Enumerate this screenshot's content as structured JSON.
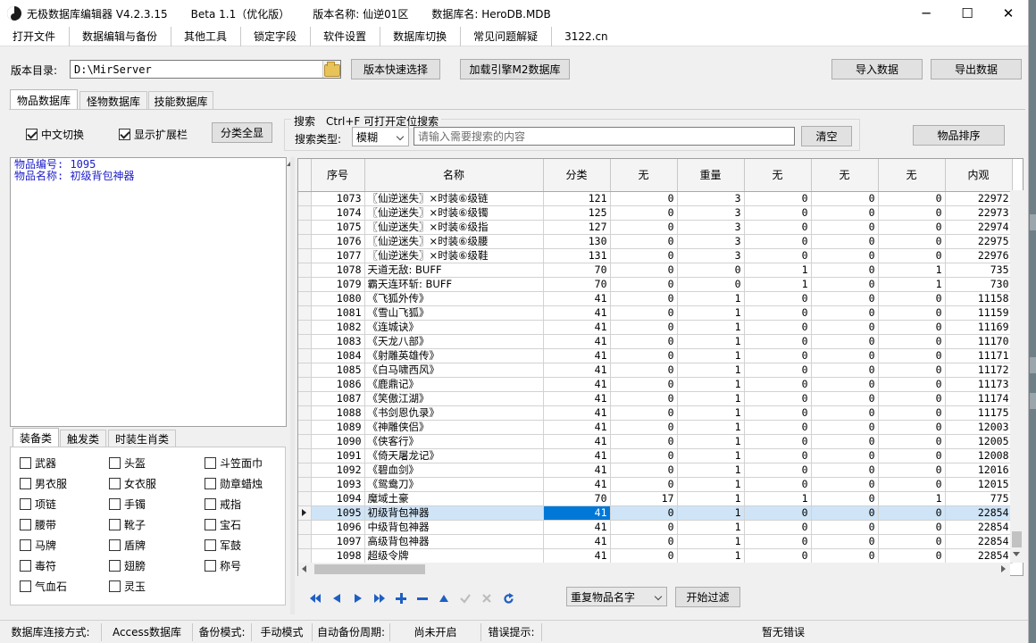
{
  "titlebar": {
    "app_name": "无极数据库编辑器 V4.2.3.15",
    "beta": "Beta 1.1（优化版）",
    "version_name": "版本名称: 仙逆01区",
    "db_name": "数据库名: HeroDB.MDB",
    "minimize": "─",
    "maximize": "☐",
    "close": "✕"
  },
  "menu": [
    "打开文件",
    "数据编辑与备份",
    "其他工具",
    "锁定字段",
    "软件设置",
    "数据库切换",
    "常见问题解疑",
    "3122.cn"
  ],
  "toolbar": {
    "dir_label": "版本目录:",
    "dir_value": "D:\\MirServer",
    "quick_select": "版本快速选择",
    "load_engine": "加载引擎M2数据库",
    "import": "导入数据",
    "export": "导出数据"
  },
  "tabs": [
    "物品数据库",
    "怪物数据库",
    "技能数据库"
  ],
  "options": {
    "chinese_toggle": "中文切换",
    "show_ext_bar": "显示扩展栏",
    "show_all_categories": "分类全显",
    "search_title": "搜索　Ctrl+F 可打开定位搜索",
    "search_type_label": "搜索类型:",
    "search_type_value": "模糊",
    "search_placeholder": "请输入需要搜索的内容",
    "clear": "清空",
    "sort_items": "物品排序"
  },
  "info": {
    "line1": "物品编号: 1095",
    "line2": "物品名称: 初级背包神器"
  },
  "category_tabs": [
    "装备类",
    "触发类",
    "时装生肖类"
  ],
  "categories": [
    "武器",
    "头盔",
    "斗笠面巾",
    "男衣服",
    "女衣服",
    "勋章蜡烛",
    "项链",
    "手镯",
    "戒指",
    "腰带",
    "靴子",
    "宝石",
    "马牌",
    "盾牌",
    "军鼓",
    "毒符",
    "翅膀",
    "称号",
    "气血石",
    "灵玉"
  ],
  "table": {
    "headers": [
      "序号",
      "名称",
      "分类",
      "无",
      "重量",
      "无",
      "无",
      "无",
      "内观"
    ],
    "rows": [
      [
        "1073",
        "〖仙逆迷失〗×时装⑥级链",
        "121",
        "0",
        "3",
        "0",
        "0",
        "0",
        "22972"
      ],
      [
        "1074",
        "〖仙逆迷失〗×时装⑥级镯",
        "125",
        "0",
        "3",
        "0",
        "0",
        "0",
        "22973"
      ],
      [
        "1075",
        "〖仙逆迷失〗×时装⑥级指",
        "127",
        "0",
        "3",
        "0",
        "0",
        "0",
        "22974"
      ],
      [
        "1076",
        "〖仙逆迷失〗×时装⑥级腰",
        "130",
        "0",
        "3",
        "0",
        "0",
        "0",
        "22975"
      ],
      [
        "1077",
        "〖仙逆迷失〗×时装⑥级鞋",
        "131",
        "0",
        "3",
        "0",
        "0",
        "0",
        "22976"
      ],
      [
        "1078",
        "天道无敌: BUFF",
        "70",
        "0",
        "0",
        "1",
        "0",
        "1",
        "735"
      ],
      [
        "1079",
        "霸天连环斩: BUFF",
        "70",
        "0",
        "0",
        "1",
        "0",
        "1",
        "730"
      ],
      [
        "1080",
        "《飞狐外传》",
        "41",
        "0",
        "1",
        "0",
        "0",
        "0",
        "11158"
      ],
      [
        "1081",
        "《雪山飞狐》",
        "41",
        "0",
        "1",
        "0",
        "0",
        "0",
        "11159"
      ],
      [
        "1082",
        "《连城诀》",
        "41",
        "0",
        "1",
        "0",
        "0",
        "0",
        "11169"
      ],
      [
        "1083",
        "《天龙八部》",
        "41",
        "0",
        "1",
        "0",
        "0",
        "0",
        "11170"
      ],
      [
        "1084",
        "《射雕英雄传》",
        "41",
        "0",
        "1",
        "0",
        "0",
        "0",
        "11171"
      ],
      [
        "1085",
        "《白马啸西风》",
        "41",
        "0",
        "1",
        "0",
        "0",
        "0",
        "11172"
      ],
      [
        "1086",
        "《鹿鼎记》",
        "41",
        "0",
        "1",
        "0",
        "0",
        "0",
        "11173"
      ],
      [
        "1087",
        "《笑傲江湖》",
        "41",
        "0",
        "1",
        "0",
        "0",
        "0",
        "11174"
      ],
      [
        "1088",
        "《书剑恩仇录》",
        "41",
        "0",
        "1",
        "0",
        "0",
        "0",
        "11175"
      ],
      [
        "1089",
        "《神雕侠侣》",
        "41",
        "0",
        "1",
        "0",
        "0",
        "0",
        "12003"
      ],
      [
        "1090",
        "《侠客行》",
        "41",
        "0",
        "1",
        "0",
        "0",
        "0",
        "12005"
      ],
      [
        "1091",
        "《倚天屠龙记》",
        "41",
        "0",
        "1",
        "0",
        "0",
        "0",
        "12008"
      ],
      [
        "1092",
        "《碧血剑》",
        "41",
        "0",
        "1",
        "0",
        "0",
        "0",
        "12016"
      ],
      [
        "1093",
        "《鸳鸯刀》",
        "41",
        "0",
        "1",
        "0",
        "0",
        "0",
        "12015"
      ],
      [
        "1094",
        "魔域土豪",
        "70",
        "17",
        "1",
        "1",
        "0",
        "1",
        "775"
      ],
      [
        "1095",
        "初级背包神器",
        "41",
        "0",
        "1",
        "0",
        "0",
        "0",
        "22854"
      ],
      [
        "1096",
        "中级背包神器",
        "41",
        "0",
        "1",
        "0",
        "0",
        "0",
        "22854"
      ],
      [
        "1097",
        "高级背包神器",
        "41",
        "0",
        "1",
        "0",
        "0",
        "0",
        "22854"
      ],
      [
        "1098",
        "超级令牌",
        "41",
        "0",
        "1",
        "0",
        "0",
        "0",
        "22854"
      ]
    ],
    "selected_row": 22
  },
  "filter": {
    "select_value": "重复物品名字",
    "start": "开始过滤"
  },
  "status": {
    "conn_label": "数据库连接方式:",
    "conn_value": "Access数据库",
    "backup_label": "备份模式:",
    "backup_value": "手动模式",
    "auto_label": "自动备份周期:",
    "auto_value": "尚未开启",
    "error_label": "错误提示:",
    "error_value": "暂无错误"
  }
}
